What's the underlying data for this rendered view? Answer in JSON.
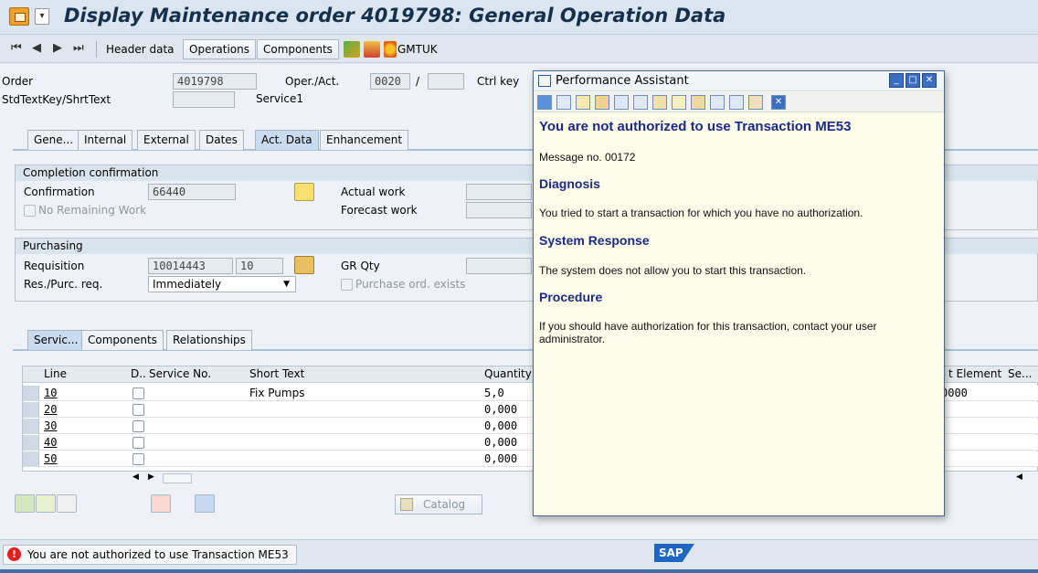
{
  "title": "Display Maintenance order 4019798: General Operation Data",
  "toolbar": {
    "header_data": "Header data",
    "operations": "Operations",
    "components": "Components",
    "gmtuk": "GMTUK"
  },
  "header": {
    "order_label": "Order",
    "order_value": "4019798",
    "operact_label": "Oper./Act.",
    "operact_value": "0020",
    "operact_sep": "/",
    "ctrlkey_label": "Ctrl key",
    "stdtext_label": "StdTextKey/ShrtText",
    "shorttext_value": "Service1"
  },
  "tabs": [
    "Gene...",
    "Internal",
    "External",
    "Dates",
    "Act. Data",
    "Enhancement"
  ],
  "completion": {
    "header": "Completion confirmation",
    "confirmation_label": "Confirmation",
    "confirmation_value": "66440",
    "no_remaining": "No Remaining Work",
    "actual_work": "Actual work",
    "forecast_work": "Forecast work"
  },
  "purchasing": {
    "header": "Purchasing",
    "requisition_label": "Requisition",
    "requisition_value": "10014443",
    "requisition_item": "10",
    "gr_qty": "GR Qty",
    "respurc_label": "Res./Purc. req.",
    "respurc_value": "Immediately",
    "purchase_exists": "Purchase ord. exists"
  },
  "subtabs": [
    "Servic...",
    "Components",
    "Relationships"
  ],
  "table": {
    "headers": {
      "line": "Line",
      "d": "D..",
      "service_no": "Service No.",
      "short_text": "Short Text",
      "quantity": "Quantity",
      "cost_element": "t Element",
      "se": "Se..."
    },
    "rows": [
      {
        "line": "10",
        "short_text": "Fix Pumps",
        "quantity": "5,0",
        "cost_element": "0000"
      },
      {
        "line": "20",
        "short_text": "",
        "quantity": "0,000",
        "cost_element": ""
      },
      {
        "line": "30",
        "short_text": "",
        "quantity": "0,000",
        "cost_element": ""
      },
      {
        "line": "40",
        "short_text": "",
        "quantity": "0,000",
        "cost_element": ""
      },
      {
        "line": "50",
        "short_text": "",
        "quantity": "0,000",
        "cost_element": ""
      }
    ],
    "catalog": "Catalog"
  },
  "popup": {
    "title": "Performance Assistant",
    "heading": "You are not authorized to use Transaction ME53",
    "message_no": "Message no. 00172",
    "diagnosis_h": "Diagnosis",
    "diagnosis_t": "You tried to start a transaction for which you have no authorization.",
    "response_h": "System Response",
    "response_t": "The system does not allow you to start this transaction.",
    "procedure_h": "Procedure",
    "procedure_t": "If you should have authorization for this transaction, contact your user administrator."
  },
  "status": {
    "message": "You are not authorized to use Transaction ME53",
    "logo": "SAP"
  },
  "colors": {
    "title_text": "#14304c",
    "popup_heading": "#1a2a86",
    "popup_bg": "#fdfce8",
    "error": "#e02020",
    "sap_blue": "#1d67c1"
  }
}
